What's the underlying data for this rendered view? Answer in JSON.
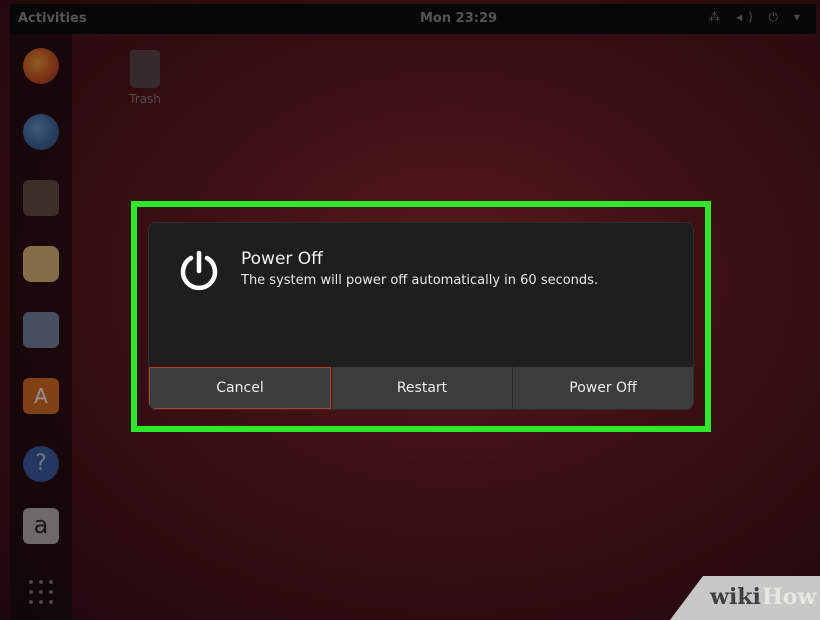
{
  "topbar": {
    "activities": "Activities",
    "clock": "Mon 23:29",
    "tray": "⁂ ◂) ⏻ ▾"
  },
  "desktop": {
    "trash_label": "Trash"
  },
  "dock": {
    "items": [
      "firefox-icon",
      "thunderbird-icon",
      "files-icon",
      "rhythmbox-icon",
      "writer-icon",
      "software-icon",
      "help-icon",
      "amazon-icon",
      "app-grid-icon"
    ],
    "amazon_letter": "a",
    "help_glyph": "?",
    "software_letter": "A"
  },
  "dialog": {
    "title": "Power Off",
    "message": "The system will power off automatically in 60 seconds.",
    "buttons": {
      "cancel": "Cancel",
      "restart": "Restart",
      "power_off": "Power Off"
    }
  },
  "watermark": {
    "wiki": "wiki",
    "how": "How"
  },
  "colors": {
    "highlight": "#2ee82a",
    "dialog_bg": "#1e1e1e",
    "button_bg": "#3c3c3c",
    "focus_border": "#c0392b"
  }
}
